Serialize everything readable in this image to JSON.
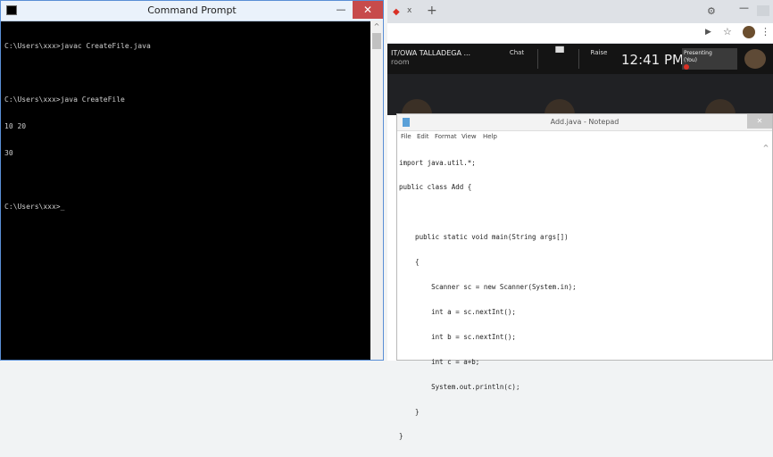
{
  "cmd": {
    "title": "Command Prompt",
    "minimize_label": "—",
    "close_label": "✕",
    "scroll_up": "^",
    "lines": [
      "C:\\Users\\xxx>javac CreateFile.java",
      "",
      "C:\\Users\\xxx>java CreateFile",
      "10 20",
      "30",
      "",
      "C:\\Users\\xxx>_"
    ]
  },
  "browser": {
    "tab_close": "x",
    "new_tab": "+",
    "gear": "⚙",
    "minimize": "—",
    "cast_icon": "▶",
    "star_icon": "☆",
    "menu_icon": "⋮",
    "tab_icon": "◆"
  },
  "meet": {
    "title": "IT/OWA TALLADEGA ...",
    "subtitle": "room",
    "buttons": [
      "Chat",
      "",
      "Raise"
    ],
    "clock": "12:41 PM",
    "presenting": "Presenting",
    "presenting_sub": "(You)"
  },
  "notepad": {
    "title": "Add.java - Notepad",
    "close_label": "✕",
    "scroll_up": "^",
    "menu": [
      "File",
      "Edit",
      "Format",
      "View",
      "Help"
    ],
    "code": [
      "import java.util.*;",
      "public class Add {",
      "",
      "    public static void main(String args[])",
      "    {",
      "        Scanner sc = new Scanner(System.in);",
      "        int a = sc.nextInt();",
      "        int b = sc.nextInt();",
      "        int c = a+b;",
      "        System.out.println(c);",
      "    }",
      "}"
    ]
  }
}
